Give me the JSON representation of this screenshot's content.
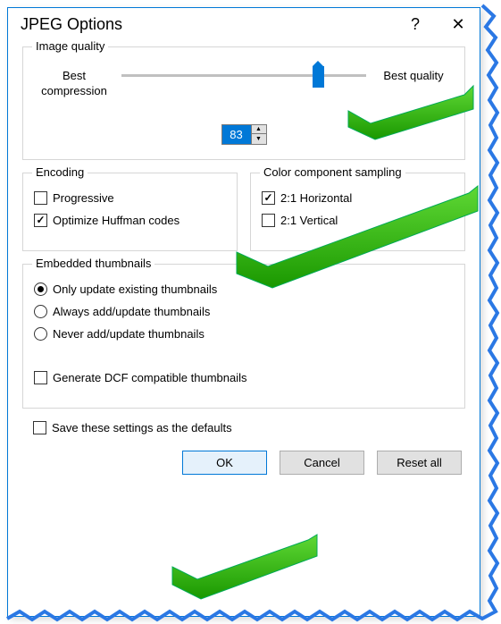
{
  "title": "JPEG Options",
  "help_label": "?",
  "close_label": "✕",
  "image_quality": {
    "legend": "Image quality",
    "left_label": "Best compression",
    "right_label": "Best quality",
    "value": "83"
  },
  "encoding": {
    "legend": "Encoding",
    "progressive": {
      "label": "Progressive",
      "checked": false
    },
    "huffman": {
      "label": "Optimize Huffman codes",
      "checked": true
    }
  },
  "sampling": {
    "legend": "Color component sampling",
    "horizontal": {
      "label": "2:1 Horizontal",
      "checked": true
    },
    "vertical": {
      "label": "2:1 Vertical",
      "checked": false
    }
  },
  "thumbnails": {
    "legend": "Embedded thumbnails",
    "options": {
      "update": {
        "label": "Only update existing thumbnails",
        "selected": true
      },
      "always": {
        "label": "Always add/update thumbnails",
        "selected": false
      },
      "never": {
        "label": "Never add/update thumbnails",
        "selected": false
      }
    },
    "dcf": {
      "label": "Generate DCF compatible thumbnails",
      "checked": false
    }
  },
  "save_defaults": {
    "label": "Save these settings as the defaults",
    "checked": false
  },
  "buttons": {
    "ok": "OK",
    "cancel": "Cancel",
    "reset": "Reset all"
  }
}
